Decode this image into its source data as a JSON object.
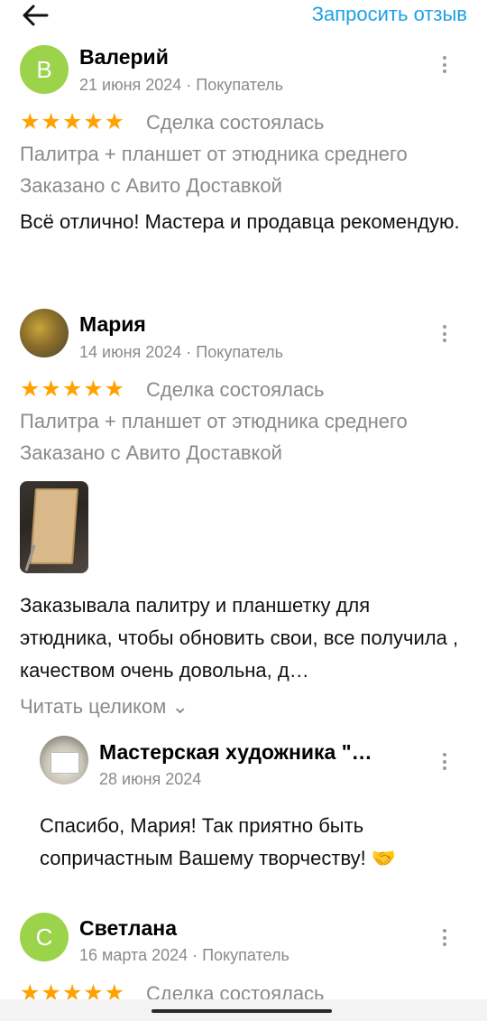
{
  "header": {
    "back_icon": "arrow-left-icon",
    "request_label": "Запросить отзыв",
    "accent": "#1ea0e6"
  },
  "reviews": [
    {
      "avatar_letter": "В",
      "avatar_color": "#9bd34a",
      "name": "Валерий",
      "meta": "21 июня 2024 · Покупатель",
      "stars": "★★★★★",
      "deal": "Сделка состоялась",
      "item": "Палитра + планшет от этюдника среднего",
      "delivery": "Заказано с Авито Доставкой",
      "text": "Всё отлично! Мастера и продавца рекомендую."
    },
    {
      "name": "Мария",
      "meta": "14 июня 2024 · Покупатель",
      "stars": "★★★★★",
      "deal": "Сделка состоялась",
      "item": "Палитра + планшет от этюдника среднего",
      "delivery": "Заказано с Авито Доставкой",
      "text": "Заказывала палитру и планшетку для этюдника, чтобы обновить свои, все получила , качеством очень довольна, д…",
      "read_more": "Читать целиком ⌄",
      "reply": {
        "name": "Мастерская художника \"…",
        "date": "28 июня 2024",
        "text": "Спасибо, Мария! Так приятно быть сопричастным Вашему творчеству! 🤝"
      }
    },
    {
      "avatar_letter": "С",
      "avatar_color": "#9bd34a",
      "name": "Светлана",
      "meta": "16 марта 2024 · Покупатель",
      "stars": "★★★★★",
      "deal": "Сделка состоялась"
    }
  ]
}
